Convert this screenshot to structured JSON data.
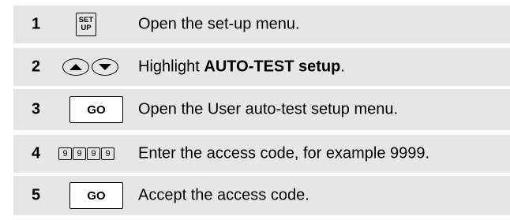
{
  "steps": [
    {
      "number": "1",
      "key": {
        "line1": "SET",
        "line2": "UP"
      },
      "text": "Open the set-up menu."
    },
    {
      "number": "2",
      "key": {
        "icons": [
          "arrow-up-icon",
          "arrow-down-icon"
        ]
      },
      "text_before": "Highlight ",
      "text_bold": "AUTO-TEST setup",
      "text_after": "."
    },
    {
      "number": "3",
      "key": {
        "label": "GO"
      },
      "text": "Open the User auto-test setup menu."
    },
    {
      "number": "4",
      "key": {
        "digits": [
          "9",
          "9",
          "9",
          "9"
        ]
      },
      "text": "Enter the access code, for example 9999."
    },
    {
      "number": "5",
      "key": {
        "label": "GO"
      },
      "text": "Accept the access code."
    }
  ],
  "colors": {
    "row_background": "#e6e6e6",
    "button_background": "#ffffff",
    "border": "#000000"
  }
}
